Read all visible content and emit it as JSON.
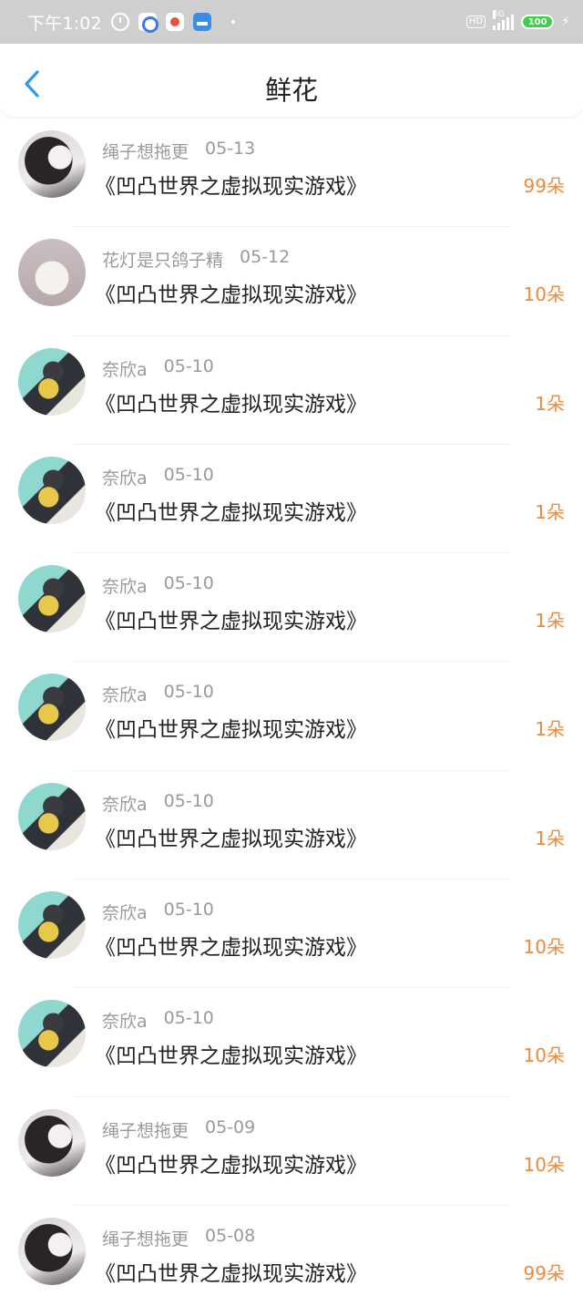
{
  "status_bar": {
    "time": "下午1:02",
    "network": "5G",
    "hd": "HD",
    "battery": "100",
    "icons": [
      "alarm-icon",
      "baidu-cloud-icon",
      "tomato-app-icon",
      "blue-app-icon",
      "hd-icon",
      "signal-icon",
      "battery-icon",
      "charging-bolt-icon"
    ]
  },
  "header": {
    "title": "鲜花",
    "back_icon": "chevron-left-icon"
  },
  "records": [
    {
      "user": "绳子想拖更",
      "date": "05-13",
      "book": "《凹凸世界之虚拟现实游戏》",
      "count": "99朵",
      "avatar": "girl"
    },
    {
      "user": "花灯是只鸽子精",
      "date": "05-12",
      "book": "《凹凸世界之虚拟现实游戏》",
      "count": "10朵",
      "avatar": "cat"
    },
    {
      "user": "奈欣a",
      "date": "05-10",
      "book": "《凹凸世界之虚拟现实游戏》",
      "count": "1朵",
      "avatar": "anime"
    },
    {
      "user": "奈欣a",
      "date": "05-10",
      "book": "《凹凸世界之虚拟现实游戏》",
      "count": "1朵",
      "avatar": "anime"
    },
    {
      "user": "奈欣a",
      "date": "05-10",
      "book": "《凹凸世界之虚拟现实游戏》",
      "count": "1朵",
      "avatar": "anime"
    },
    {
      "user": "奈欣a",
      "date": "05-10",
      "book": "《凹凸世界之虚拟现实游戏》",
      "count": "1朵",
      "avatar": "anime"
    },
    {
      "user": "奈欣a",
      "date": "05-10",
      "book": "《凹凸世界之虚拟现实游戏》",
      "count": "1朵",
      "avatar": "anime"
    },
    {
      "user": "奈欣a",
      "date": "05-10",
      "book": "《凹凸世界之虚拟现实游戏》",
      "count": "10朵",
      "avatar": "anime"
    },
    {
      "user": "奈欣a",
      "date": "05-10",
      "book": "《凹凸世界之虚拟现实游戏》",
      "count": "10朵",
      "avatar": "anime"
    },
    {
      "user": "绳子想拖更",
      "date": "05-09",
      "book": "《凹凸世界之虚拟现实游戏》",
      "count": "10朵",
      "avatar": "girl"
    },
    {
      "user": "绳子想拖更",
      "date": "05-08",
      "book": "《凹凸世界之虚拟现实游戏》",
      "count": "99朵",
      "avatar": "girl"
    }
  ],
  "colors": {
    "accent_blue": "#2a9bf0",
    "count_orange": "#ef8a3b",
    "meta_gray": "#9a9a9a",
    "title_text": "#222222",
    "status_bar_bg": "#cfcfcf"
  }
}
